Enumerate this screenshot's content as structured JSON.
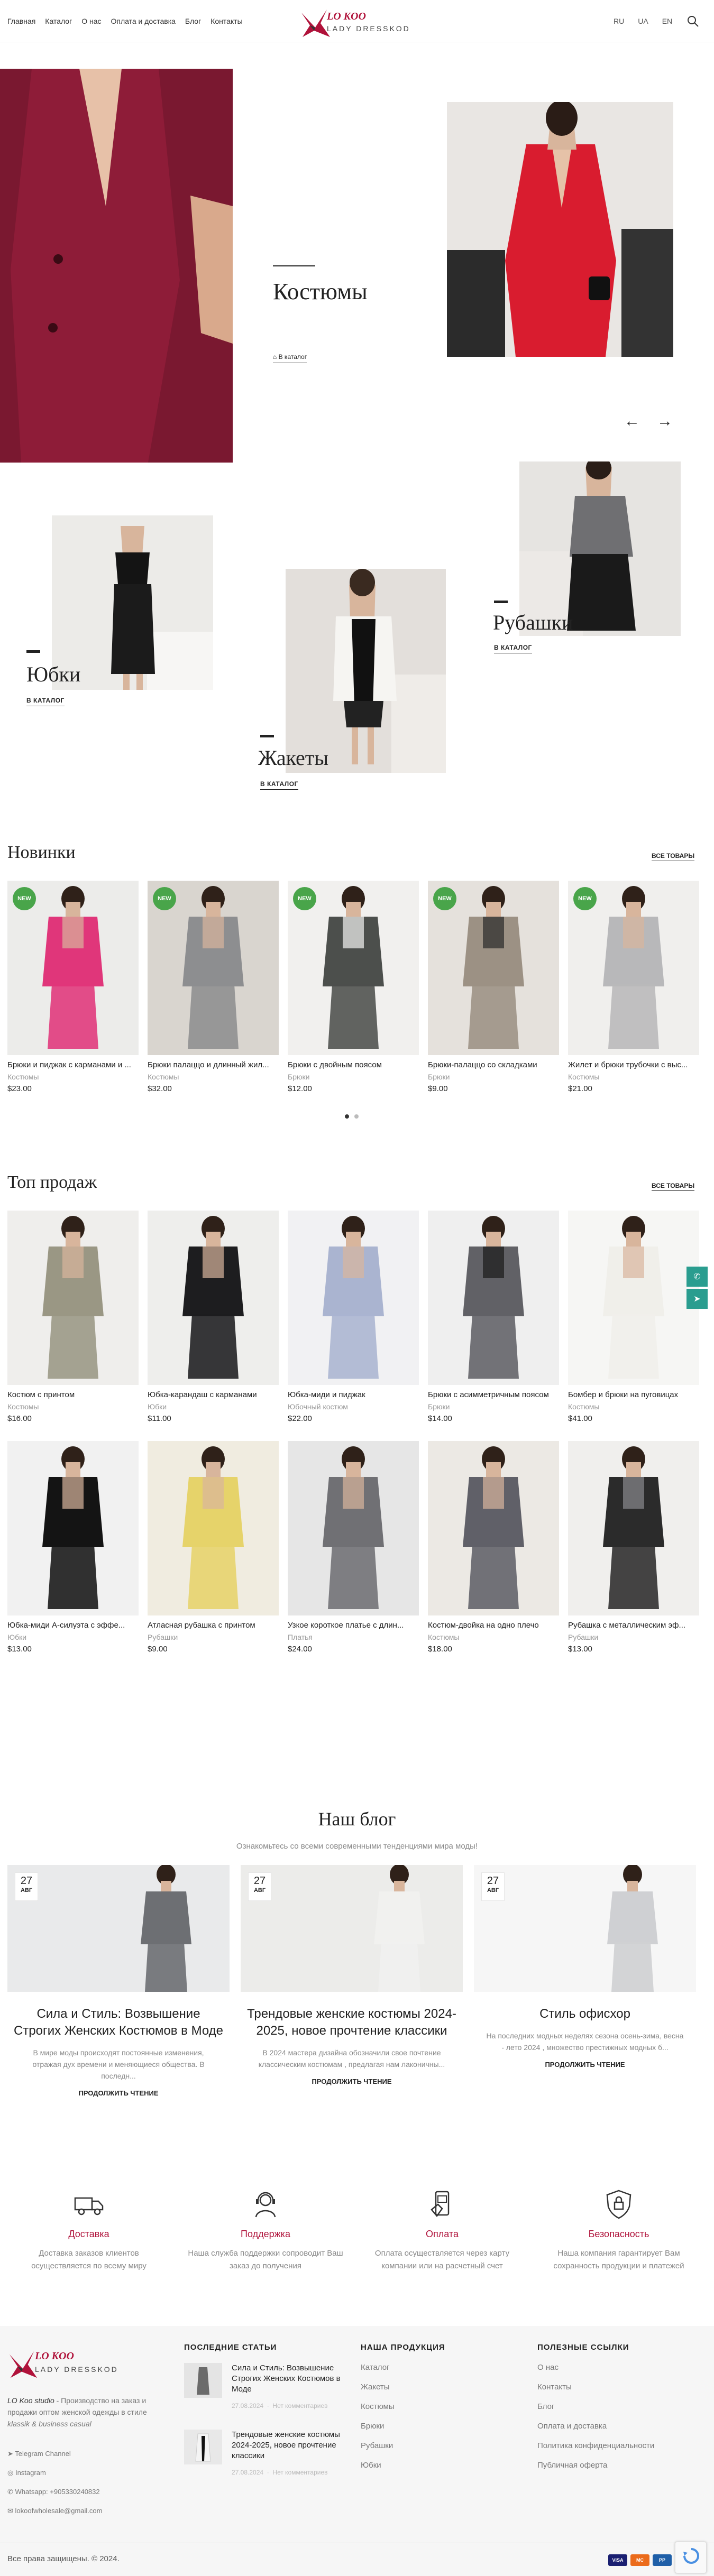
{
  "header": {
    "nav": [
      "Главная",
      "Каталог",
      "О нас",
      "Оплата и доставка",
      "Блог",
      "Контакты"
    ],
    "logo_top": "LO KOO",
    "logo_bottom": "LADY DRESSKOD",
    "langs": [
      "RU",
      "UA",
      "EN"
    ]
  },
  "hero": {
    "title": "Костюмы",
    "link": "В каталог"
  },
  "categories": [
    {
      "title": "Юбки",
      "link": "В КАТАЛОГ"
    },
    {
      "title": "Жакеты",
      "link": "В КАТАЛОГ"
    },
    {
      "title": "Рубашки",
      "link": "В КАТАЛОГ"
    }
  ],
  "new_section": {
    "title": "Новинки",
    "all_link": "ВСЕ ТОВАРЫ",
    "badge": "NEW",
    "products": [
      {
        "name": "Брюки и пиджак с карманами и ...",
        "category": "Костюмы",
        "price": "$23.00"
      },
      {
        "name": "Брюки палаццо и длинный жил...",
        "category": "Костюмы",
        "price": "$32.00"
      },
      {
        "name": "Брюки с двойным поясом",
        "category": "Брюки",
        "price": "$12.00"
      },
      {
        "name": "Брюки-палаццо со складками",
        "category": "Брюки",
        "price": "$9.00"
      },
      {
        "name": "Жилет и брюки трубочки с выс...",
        "category": "Костюмы",
        "price": "$21.00"
      }
    ]
  },
  "top_section": {
    "title": "Топ продаж",
    "all_link": "ВСЕ ТОВАРЫ",
    "products": [
      {
        "name": "Костюм с принтом",
        "category": "Костюмы",
        "price": "$16.00"
      },
      {
        "name": "Юбка-карандаш с карманами",
        "category": "Юбки",
        "price": "$11.00"
      },
      {
        "name": "Юбка-миди и пиджак",
        "category": "Юбочный костюм",
        "price": "$22.00"
      },
      {
        "name": "Брюки с асимметричным поясом",
        "category": "Брюки",
        "price": "$14.00"
      },
      {
        "name": "Бомбер и брюки на пуговицах",
        "category": "Костюмы",
        "price": "$41.00"
      },
      {
        "name": "Юбка-миди А-силуэта с эффе...",
        "category": "Юбки",
        "price": "$13.00"
      },
      {
        "name": "Атласная рубашка с принтом",
        "category": "Рубашки",
        "price": "$9.00"
      },
      {
        "name": "Узкое короткое платье с длин...",
        "category": "Платья",
        "price": "$24.00"
      },
      {
        "name": "Костюм-двойка на одно плечо",
        "category": "Костюмы",
        "price": "$18.00"
      },
      {
        "name": "Рубашка с металлическим эф...",
        "category": "Рубашки",
        "price": "$13.00"
      }
    ]
  },
  "blog": {
    "title": "Наш блог",
    "subtitle": "Ознакомьтесь со всеми современными тенденциями мира моды!",
    "more": "ПРОДОЛЖИТЬ ЧТЕНИЕ",
    "posts": [
      {
        "day": "27",
        "month": "АВГ",
        "title": "Сила и Стиль: Возвышение Строгих Женских Костюмов в Моде",
        "excerpt": "В мире моды происходят постоянные изменения, отражая дух времени и меняющиеся общества. В последн..."
      },
      {
        "day": "27",
        "month": "АВГ",
        "title": "Трендовые женские костюмы 2024-2025, новое прочтение классики",
        "excerpt": "В 2024 мастера дизайна обозначили свое почтение классическим костюмам , предлагая нам лаконичны..."
      },
      {
        "day": "27",
        "month": "АВГ",
        "title": "Стиль офисхор",
        "excerpt": "На последних модных неделях сезона осень-зима, весна - лето 2024 , множество престижных модных б..."
      }
    ]
  },
  "features": [
    {
      "title": "Доставка",
      "desc": "Доставка заказов клиентов осуществляется по всему миру",
      "icon": "truck-icon"
    },
    {
      "title": "Поддержка",
      "desc": "Наша служба поддержки сопроводит Ваш заказ до получения",
      "icon": "support-icon"
    },
    {
      "title": "Оплата",
      "desc": "Оплата осуществляется через карту компании или на расчетный счет",
      "icon": "payment-icon"
    },
    {
      "title": "Безопасность",
      "desc": "Наша компания гарантирует Вам сохранность продукции и платежей",
      "icon": "security-icon"
    }
  ],
  "footer": {
    "about_1": "LO Koo studio",
    "about_2": " - Производство на заказ и продажи оптом женской одежды в стиле",
    "about_3": "klassik & business casual",
    "contacts": [
      "Telegram Channel",
      "Instagram",
      "Whatsapp: +905330240832",
      "lokoofwholesale@gmail.com"
    ],
    "recent_head": "ПОСЛЕДНИЕ СТАТЬИ",
    "recent": [
      {
        "title": "Сила и Стиль: Возвышение Строгих Женских Костюмов в Моде",
        "date": "27.08.2024",
        "comments": "Нет комментариев"
      },
      {
        "title": "Трендовые женские костюмы 2024-2025, новое прочтение классики",
        "date": "27.08.2024",
        "comments": "Нет комментариев"
      }
    ],
    "products_head": "НАША ПРОДУКЦИЯ",
    "products": [
      "Каталог",
      "Жакеты",
      "Костюмы",
      "Брюки",
      "Рубашки",
      "Юбки"
    ],
    "useful_head": "ПОЛЕЗНЫЕ ССЫЛКИ",
    "useful": [
      "О нас",
      "Контакты",
      "Блог",
      "Оплата и доставка",
      "Политика конфиденциальности",
      "Публичная оферта"
    ],
    "copyright": "Все права защищены. © 2024.",
    "payments": [
      "VISA",
      "MC",
      "PP"
    ]
  },
  "colors": {
    "accent": "#b0123a",
    "new_badge": "#49a54a",
    "side_button": "#2a9d8f"
  }
}
